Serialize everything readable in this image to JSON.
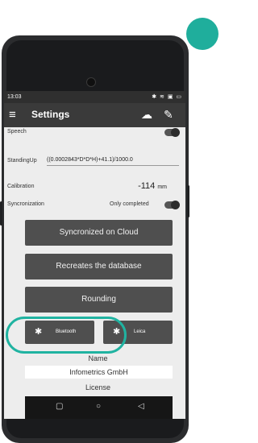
{
  "status_bar": {
    "time": "13:03",
    "icons_text": "✱ ≋ ▣ ▭"
  },
  "app_bar": {
    "title": "Settings",
    "menu_icon": "menu-icon",
    "cloud_icon": "cloud-download-icon",
    "save_icon": "save-edit-icon"
  },
  "settings": {
    "speech_label": "Speech",
    "standingup_label": "StandingUp",
    "standingup_value": "((0.0002843*D*D*H)+41.1)/1000.0",
    "calibration_label": "Calibration",
    "calibration_value": "-114",
    "calibration_unit": "mm",
    "sync_label": "Syncronization",
    "sync_value": "Only completed"
  },
  "buttons": {
    "sync_cloud": "Syncronized on Cloud",
    "recreate_db": "Recreates the database",
    "rounding": "Rounding",
    "bluetooth": "Bluetooth",
    "leica": "Leica"
  },
  "name_section": {
    "label": "Name",
    "value": "Infometrics GmbH"
  },
  "license_label": "License",
  "nav": {
    "square": "▢",
    "home": "○",
    "back": "◁"
  },
  "colors": {
    "highlight": "#20b3a1",
    "appbar": "#3a3a3a",
    "button": "#4f4f4f"
  }
}
